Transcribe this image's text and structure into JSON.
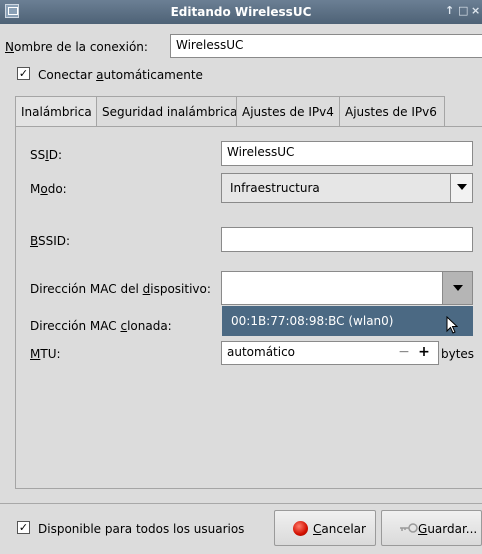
{
  "window": {
    "title": "Editando WirelessUC",
    "controls": {
      "restore": "↑",
      "maximize": "□",
      "close": "×"
    },
    "icon": "network-window-icon"
  },
  "connection_name": {
    "label": "Nombre de la conexión:",
    "mnemonic": "N",
    "label_rest": "ombre de la conexión:",
    "value": "WirelessUC"
  },
  "autoconnect": {
    "check": "✓",
    "prefix": "Conectar ",
    "mnemonic": "a",
    "rest": "utomáticamente"
  },
  "tabs": [
    {
      "label": "Inalámbrica"
    },
    {
      "label": "Seguridad inalámbrica"
    },
    {
      "label": "Ajustes de IPv4"
    },
    {
      "label": "Ajustes de IPv6"
    }
  ],
  "fields": {
    "ssid": {
      "pre": "SS",
      "mnemonic": "I",
      "post": "D:",
      "value": "WirelessUC"
    },
    "mode": {
      "pre": "M",
      "mnemonic": "o",
      "post": "do:",
      "value": "Infraestructura"
    },
    "bssid": {
      "pre": "",
      "mnemonic": "B",
      "post": "SSID:",
      "value": ""
    },
    "device_mac": {
      "pre": "Dirección MAC del ",
      "mnemonic": "d",
      "post": "ispositivo:",
      "value": "",
      "option": "00:1B:77:08:98:BC (wlan0)"
    },
    "cloned_mac": {
      "pre": "Dirección MAC ",
      "mnemonic": "c",
      "post": "lonada:"
    },
    "mtu": {
      "pre": "",
      "mnemonic": "M",
      "post": "TU:",
      "value": "automático",
      "minus": "−",
      "plus": "+",
      "unit": "bytes"
    }
  },
  "footer": {
    "available_all": {
      "check": "✓",
      "label": "Disponible para todos los usuarios"
    },
    "cancel": {
      "mnemonic": "C",
      "rest": "ancelar",
      "icon": "stop-icon"
    },
    "save": {
      "mnemonic": "G",
      "rest": "uardar...",
      "icon": "key-icon"
    }
  },
  "colors": {
    "titlebar": "#5a6e82",
    "selection": "#4b6983",
    "cancel_icon": "#d20f00"
  }
}
